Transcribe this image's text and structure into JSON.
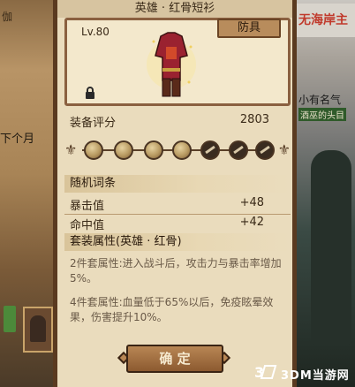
{
  "background": {
    "left_top": "伽",
    "left_text": "下个月",
    "right_sign": "无海岸主",
    "right_name": "小有名气",
    "right_sub": "酒巫的头目"
  },
  "dialog": {
    "title": "英雄 · 红骨短衫",
    "level": "Lv.80",
    "type_tag": "防具",
    "score_label": "装备评分",
    "score_value": "2803",
    "random_title": "随机词条",
    "stats": [
      {
        "name": "暴击值",
        "value": "+48"
      },
      {
        "name": "命中值",
        "value": "+42"
      }
    ],
    "set_title": "套装属性(英雄 · 红骨)",
    "set_effects": [
      "2件套属性:进入战斗后，攻击力与暴击率增加5%。",
      "4件套属性:血量低于65%以后，免疫眩晕效果，伤害提升10%。"
    ],
    "confirm_label": "确 定",
    "gem_slots": [
      "filled",
      "filled",
      "filled",
      "filled",
      "locked",
      "locked",
      "locked"
    ]
  },
  "colors": {
    "panel": "#eadcbd",
    "frame": "#5a3a20",
    "button": "#8c5a30"
  },
  "watermark": "3DM当游网"
}
